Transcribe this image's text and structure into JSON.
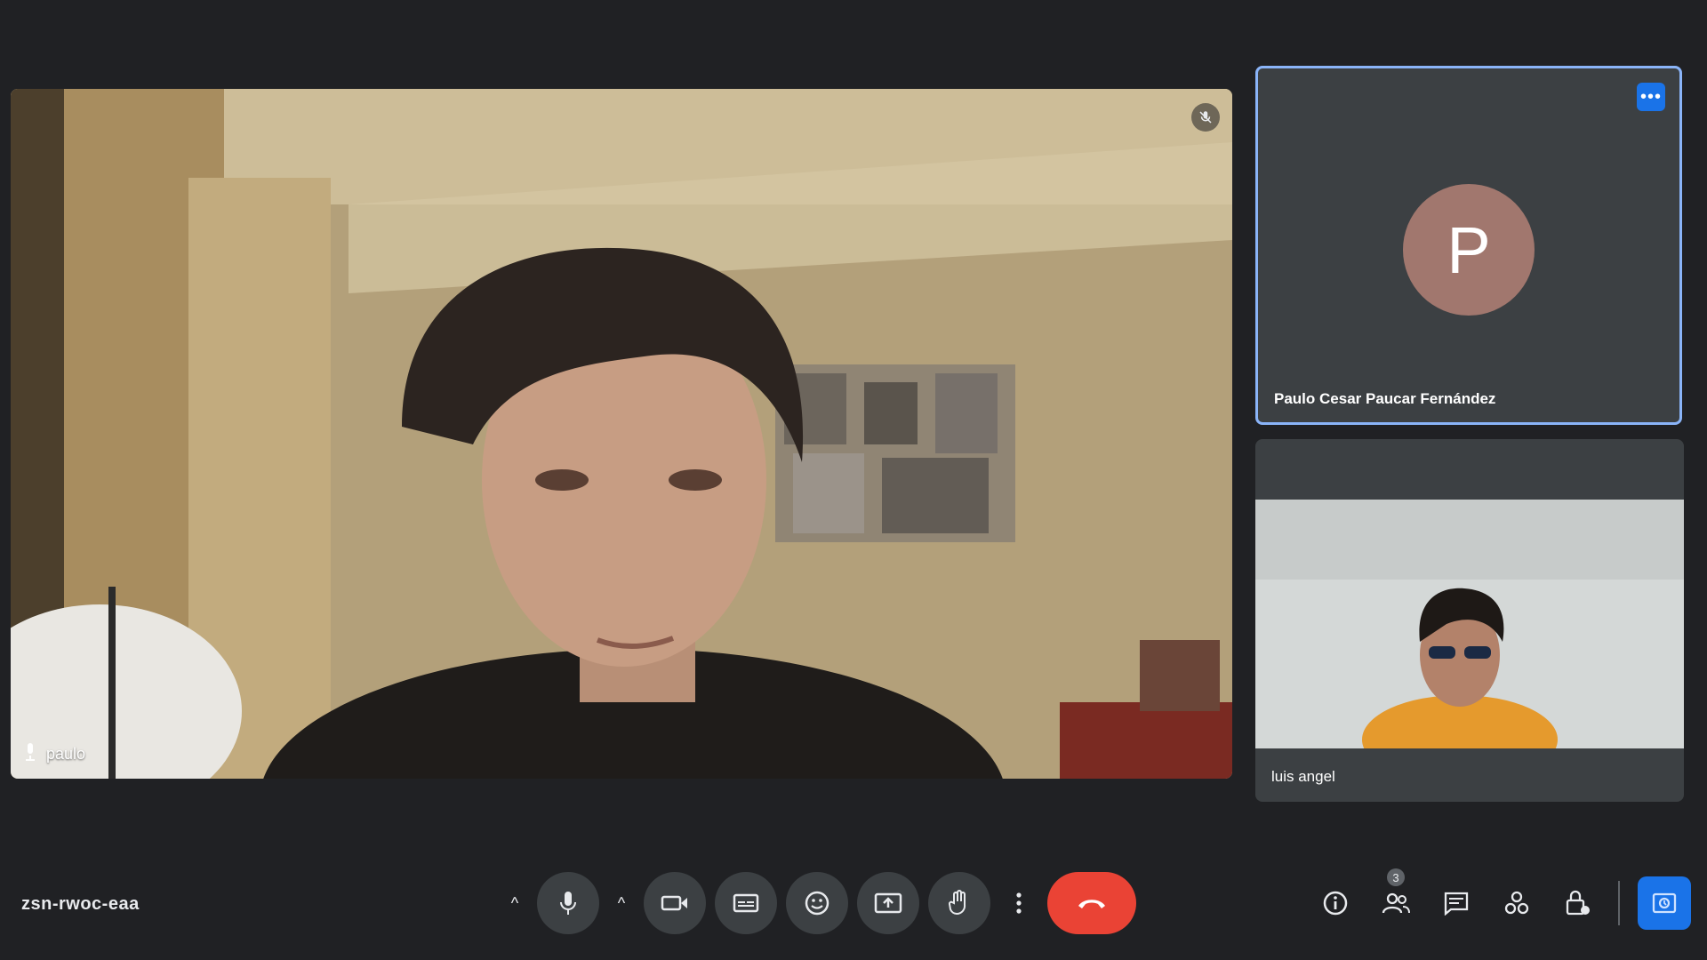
{
  "meeting": {
    "code": "zsn-rwoc-eaa"
  },
  "main_tile": {
    "name": "paulo"
  },
  "participants": [
    {
      "name": "Paulo Cesar Paucar Fernández",
      "initial": "P",
      "avatar_color": "#a1776e",
      "highlighted": true
    },
    {
      "name": "luis angel"
    }
  ],
  "controls": {
    "left": [
      "mic",
      "camera",
      "captions",
      "emoji",
      "present",
      "raise-hand",
      "more-options",
      "end-call"
    ],
    "right": [
      "info",
      "people",
      "chat",
      "activities",
      "host-controls",
      "companion"
    ]
  },
  "people_count": "3",
  "colors": {
    "background": "#202124",
    "end_call": "#ea4335",
    "accent": "#1a73e8",
    "highlight_border": "#8ab4f8"
  }
}
